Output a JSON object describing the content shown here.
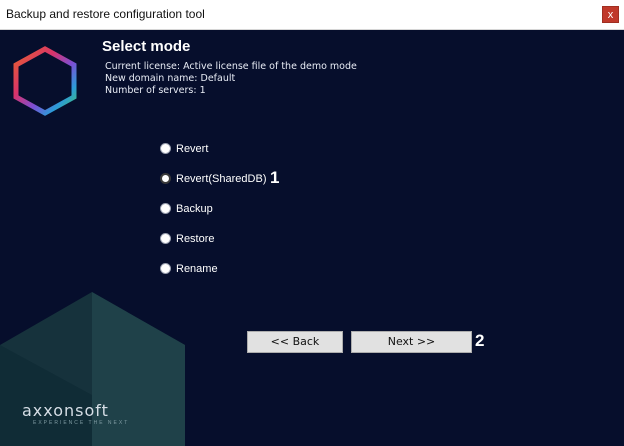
{
  "window": {
    "title": "Backup and restore configuration tool",
    "close_label": "x"
  },
  "header": {
    "title": "Select mode",
    "info": [
      "Current license: Active license file of the demo mode",
      "New domain name: Default",
      "Number of servers: 1"
    ]
  },
  "modes": {
    "items": [
      {
        "label": "Revert",
        "selected": false
      },
      {
        "label": "Revert(SharedDB)",
        "selected": true
      },
      {
        "label": "Backup",
        "selected": false
      },
      {
        "label": "Restore",
        "selected": false
      },
      {
        "label": "Rename",
        "selected": false
      }
    ],
    "marker": "1"
  },
  "buttons": {
    "back": "<< Back",
    "next": "Next >>",
    "marker": "2"
  },
  "brand": {
    "name": "axxonsoft",
    "tagline": "EXPERIENCE THE NEXT"
  },
  "colors": {
    "background": "#060e2c",
    "accent_teal": "#1e3b45",
    "close": "#c0392b"
  },
  "icons": {
    "logo": "hexagon-logo-icon",
    "close": "close-icon"
  }
}
